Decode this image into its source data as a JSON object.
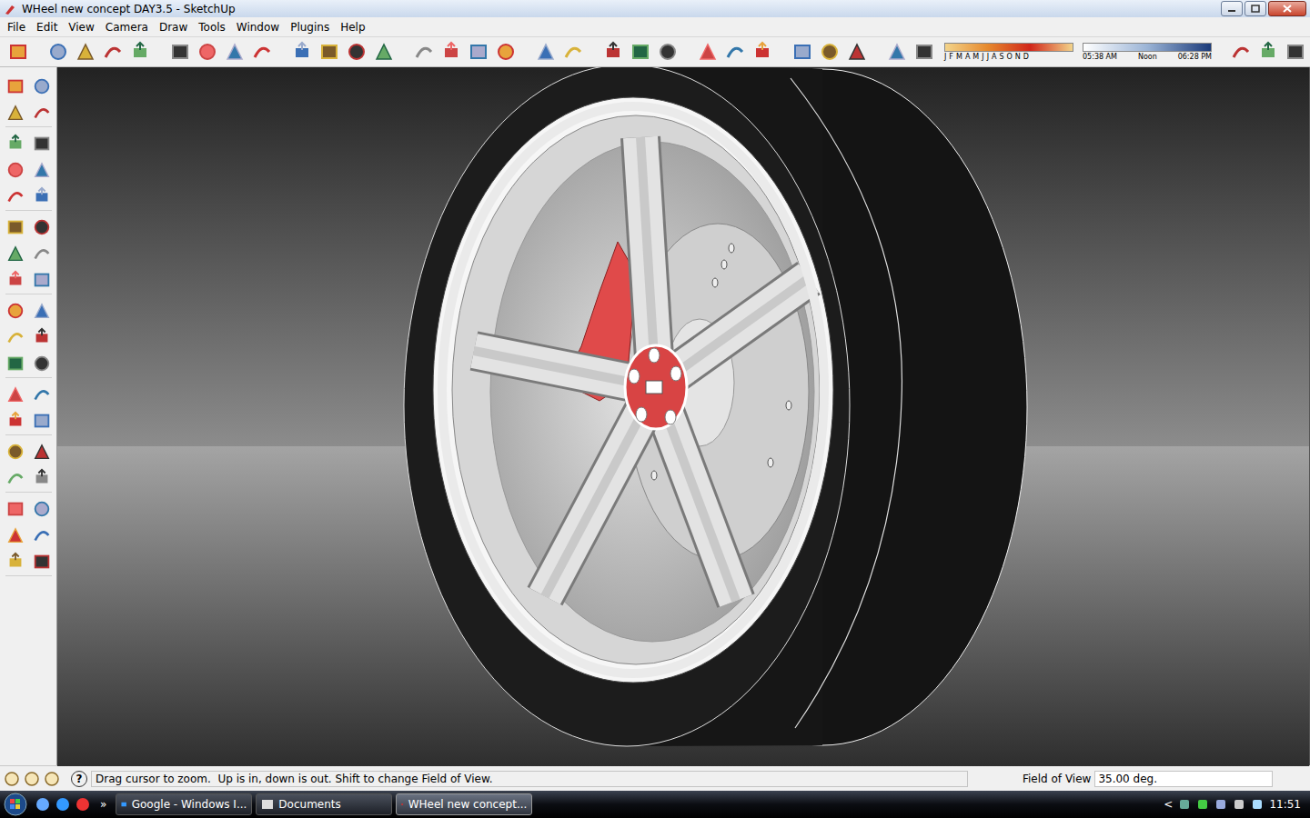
{
  "window": {
    "title": "WHeel new concept DAY3.5 - SketchUp"
  },
  "menu": [
    "File",
    "Edit",
    "View",
    "Camera",
    "Draw",
    "Tools",
    "Window",
    "Plugins",
    "Help"
  ],
  "shadow_toolbar": {
    "months": [
      "J",
      "F",
      "M",
      "A",
      "M",
      "J",
      "J",
      "A",
      "S",
      "O",
      "N",
      "D"
    ],
    "start_time": "05:38 AM",
    "mid_time": "Noon",
    "end_time": "06:28 PM"
  },
  "status_bar": {
    "help": "?",
    "message": "Drag cursor to zoom.  Up is in, down is out. Shift to change Field of View.",
    "field_label": "Field of View",
    "field_value": "35.00 deg."
  },
  "taskbar": {
    "more": "»",
    "items": [
      {
        "label": "Google - Windows I...",
        "selected": false
      },
      {
        "label": "Documents",
        "selected": false
      },
      {
        "label": "WHeel new concept...",
        "selected": true
      }
    ],
    "tray_arrow": "<",
    "clock": "11:51"
  }
}
